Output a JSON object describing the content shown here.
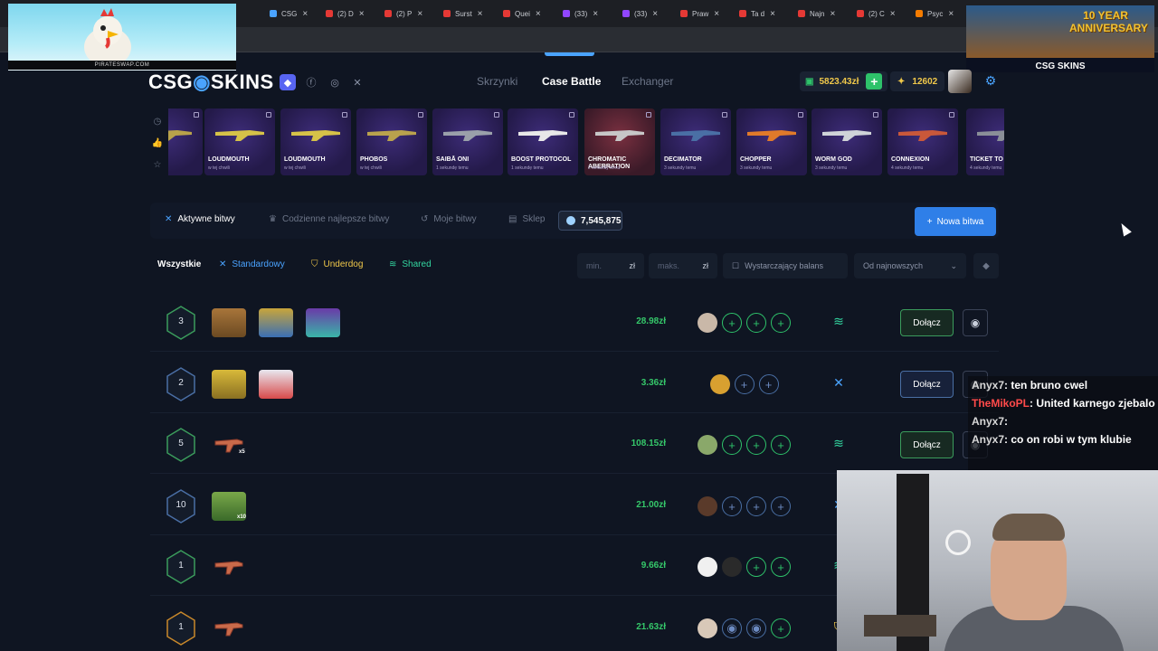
{
  "browser": {
    "tabs": [
      {
        "label": "CSG",
        "color": "#4aa3ff"
      },
      {
        "label": "(2) D",
        "color": "#e53935"
      },
      {
        "label": "(2) P",
        "color": "#e53935"
      },
      {
        "label": "Surst",
        "color": "#e53935"
      },
      {
        "label": "Quei",
        "color": "#e53935"
      },
      {
        "label": "(33) ",
        "color": "#9146ff"
      },
      {
        "label": "(33) ",
        "color": "#9146ff"
      },
      {
        "label": "Praw",
        "color": "#e53935"
      },
      {
        "label": "Ta d",
        "color": "#e53935"
      },
      {
        "label": "Najn",
        "color": "#e53935"
      },
      {
        "label": "(2) C",
        "color": "#e53935"
      },
      {
        "label": "Psyc",
        "color": "#f57c00"
      }
    ]
  },
  "overlays": {
    "left_label": "PIRATESWAP.COM",
    "right_anniversary": "10 YEAR ANNIVERSARY",
    "right_brand": "CSG SKINS"
  },
  "header": {
    "logo_a": "CSG",
    "logo_b": "SKINS",
    "nav": [
      "Skrzynki",
      "Case Battle",
      "Exchanger"
    ],
    "active_nav": "Case Battle",
    "balance": "5823.43zł",
    "points": "12602"
  },
  "drops": [
    {
      "name": "",
      "sub": ""
    },
    {
      "name": "LOUDMOUTH",
      "sub": "w tej chwili"
    },
    {
      "name": "LOUDMOUTH",
      "sub": "w tej chwili"
    },
    {
      "name": "PHOBOS",
      "sub": "w tej chwili"
    },
    {
      "name": "SAIBĀ ONI",
      "sub": "1 sekundę temu"
    },
    {
      "name": "BOOST PROTOCOL",
      "sub": "1 sekundę temu"
    },
    {
      "name": "CHROMATIC ABERRATION",
      "sub": "2 sekundy temu"
    },
    {
      "name": "DECIMATOR",
      "sub": "3 sekundy temu"
    },
    {
      "name": "CHOPPER",
      "sub": "3 sekundy temu"
    },
    {
      "name": "WORM GOD",
      "sub": "3 sekundy temu"
    },
    {
      "name": "CONNEXION",
      "sub": "4 sekundy temu"
    },
    {
      "name": "TICKET TO",
      "sub": "4 sekundy temu"
    }
  ],
  "tabs": {
    "active": "Aktywne bitwy",
    "best": "Codzienne najlepsze bitwy",
    "mine": "Moje bitwy",
    "shop": "Sklep",
    "gems": "7,545,875",
    "new_battle": "Nowa bitwa"
  },
  "filters": {
    "all": "Wszystkie",
    "standard": "Standardowy",
    "underdog": "Underdog",
    "shared": "Shared",
    "min_placeholder": "min.",
    "max_placeholder": "maks.",
    "currency": "zł",
    "sufficient": "Wystarczający balans",
    "sort": "Od najnowszych"
  },
  "battles": [
    {
      "rounds": "3",
      "price": "28.98zł",
      "join": "Dołącz",
      "mode": "shared"
    },
    {
      "rounds": "2",
      "price": "3.36zł",
      "join": "Dołącz",
      "mode": "standard"
    },
    {
      "rounds": "5",
      "price": "108.15zł",
      "join": "Dołącz",
      "mode": "shared",
      "mult": "x5"
    },
    {
      "rounds": "10",
      "price": "21.00zł",
      "join": "",
      "mode": "standard",
      "mult": "x10"
    },
    {
      "rounds": "1",
      "price": "9.66zł",
      "join": "",
      "mode": "shared"
    },
    {
      "rounds": "1",
      "price": "21.63zł",
      "join": "",
      "mode": "underdog"
    }
  ],
  "chat": [
    {
      "user": "Anyx7",
      "text": ": ten bruno cwel"
    },
    {
      "user": "TheMikoPL",
      "text": ": United karnego zjebalo"
    },
    {
      "user": "Anyx7",
      "text": ":"
    },
    {
      "user": "Anyx7",
      "text": ": co on robi w tym klubie"
    }
  ]
}
